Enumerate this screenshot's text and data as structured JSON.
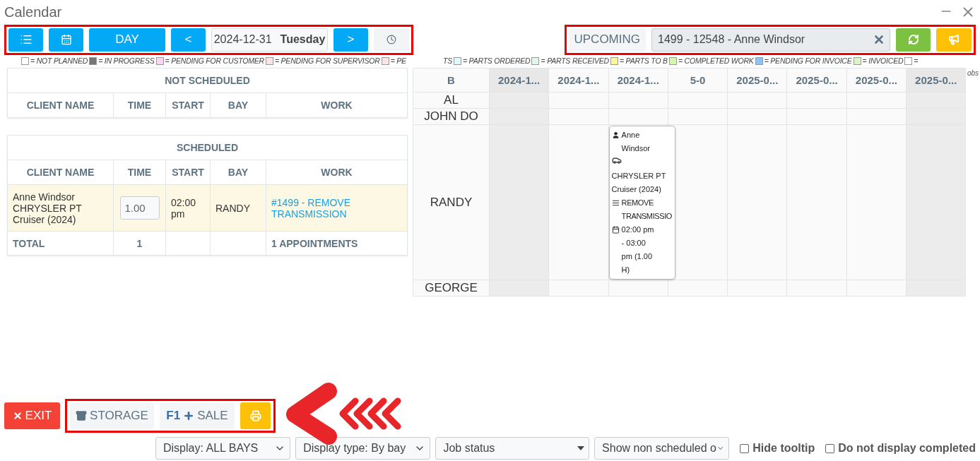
{
  "window": {
    "title": "Calendar"
  },
  "toolbar": {
    "day": "DAY",
    "prev": "<",
    "date": "2024-12-31",
    "weekday": "Tuesday",
    "next": ">"
  },
  "search": {
    "mode": "UPCOMING",
    "value": "1499 - 12548 - Anne Windsor"
  },
  "legend": [
    {
      "kind": "swatch",
      "color": "#ffffff",
      "label": "= NOT PLANNED"
    },
    {
      "kind": "swatch",
      "color": "#777777",
      "label": "= IN PROGRESS"
    },
    {
      "kind": "swatch",
      "color": "#f9d6f3",
      "label": "= PENDING FOR CUSTOMER"
    },
    {
      "kind": "swatch",
      "color": "#fde3e3",
      "label": "= PENDING FOR SUPERVISOR"
    },
    {
      "kind": "swatch",
      "color": "#fde3e3",
      "label": "= PE"
    },
    {
      "kind": "fragment",
      "label": "TS"
    },
    {
      "kind": "swatch",
      "color": "#dff8fb",
      "label": "= PARTS ORDERED"
    },
    {
      "kind": "swatch",
      "color": "#e2f8ea",
      "label": "= PARTS RECEIVED"
    },
    {
      "kind": "swatch",
      "color": "#fbf59c",
      "label": "= PARTS TO B"
    },
    {
      "kind": "swatch",
      "color": "#d6f7b0",
      "label": "= COMPLETED WORK"
    },
    {
      "kind": "swatch",
      "color": "#8fc3f2",
      "label": "= PENDING FOR INVOICE"
    },
    {
      "kind": "swatch",
      "color": "#dcf5c4",
      "label": "= INVOICED"
    },
    {
      "kind": "swatch",
      "color": "#ffffff",
      "label": "="
    }
  ],
  "legend_overflow": "obs",
  "not_scheduled": {
    "title": "NOT SCHEDULED",
    "columns": [
      "CLIENT NAME",
      "TIME",
      "START",
      "BAY",
      "WORK"
    ]
  },
  "scheduled": {
    "title": "SCHEDULED",
    "columns": [
      "CLIENT NAME",
      "TIME",
      "START",
      "BAY",
      "WORK"
    ],
    "rows": [
      {
        "client": "Anne Windsor CHRYSLER PT Cruiser (2024)",
        "time": "1.00",
        "start": "02:00 pm",
        "bay": "RANDY",
        "work": "#1499 - REMOVE TRANSMISSION"
      }
    ],
    "total": {
      "label": "TOTAL",
      "time": "1",
      "appointments": "1 APPOINTMENTS"
    }
  },
  "grid": {
    "columns": [
      {
        "label": "B",
        "shaded": false
      },
      {
        "label": "2024-1...",
        "shaded": true
      },
      {
        "label": "2024-1...",
        "shaded": false
      },
      {
        "label": "2024-1...",
        "shaded": false
      },
      {
        "label": "5-0",
        "shaded": false
      },
      {
        "label": "2025-0...",
        "shaded": false
      },
      {
        "label": "2025-0...",
        "shaded": false
      },
      {
        "label": "2025-0...",
        "shaded": false
      },
      {
        "label": "2025-0...",
        "shaded": true
      }
    ],
    "rows": [
      {
        "cells": [
          {
            "kind": "bay",
            "label": "AL"
          },
          {
            "kind": "empty"
          },
          {
            "kind": "empty"
          },
          {
            "kind": "empty"
          },
          {
            "kind": "empty"
          },
          {
            "kind": "empty"
          },
          {
            "kind": "empty"
          },
          {
            "kind": "empty"
          },
          {
            "kind": "empty"
          }
        ]
      },
      {
        "cells": [
          {
            "kind": "bay",
            "label": "JOHN DO"
          },
          {
            "kind": "empty"
          },
          {
            "kind": "empty"
          },
          {
            "kind": "empty"
          },
          {
            "kind": "empty"
          },
          {
            "kind": "empty"
          },
          {
            "kind": "empty"
          },
          {
            "kind": "empty"
          },
          {
            "kind": "empty"
          }
        ]
      },
      {
        "cells": [
          {
            "kind": "bay",
            "label": "RANDY"
          },
          {
            "kind": "empty"
          },
          {
            "kind": "empty"
          },
          {
            "kind": "event",
            "client": "Anne Windsor",
            "vehicle": "CHRYSLER PT Cruiser (2024)",
            "work": "REMOVE TRANSMISSIO",
            "time": "02:00 pm - 03:00 pm (1.00 H)"
          },
          {
            "kind": "empty"
          },
          {
            "kind": "empty"
          },
          {
            "kind": "empty"
          },
          {
            "kind": "empty"
          },
          {
            "kind": "empty"
          }
        ]
      },
      {
        "cells": [
          {
            "kind": "bay",
            "label": "GEORGE"
          },
          {
            "kind": "empty"
          },
          {
            "kind": "empty"
          },
          {
            "kind": "empty"
          },
          {
            "kind": "empty"
          },
          {
            "kind": "empty"
          },
          {
            "kind": "empty"
          },
          {
            "kind": "empty"
          },
          {
            "kind": "empty"
          }
        ]
      }
    ]
  },
  "actions": {
    "exit": "EXIT",
    "storage": "STORAGE",
    "sale_key": "F1",
    "sale": "SALE"
  },
  "filters": [
    {
      "label": "Display: ALL BAYS",
      "kind": "chevron"
    },
    {
      "label": "Display type: By bay",
      "kind": "chevron"
    },
    {
      "label": "Job status",
      "kind": "triangle"
    },
    {
      "label": "Show non scheduled o",
      "kind": "chevron"
    }
  ],
  "options": [
    {
      "label": "Hide tooltip",
      "checked": false
    },
    {
      "label": "Do not display completed",
      "checked": false
    }
  ]
}
